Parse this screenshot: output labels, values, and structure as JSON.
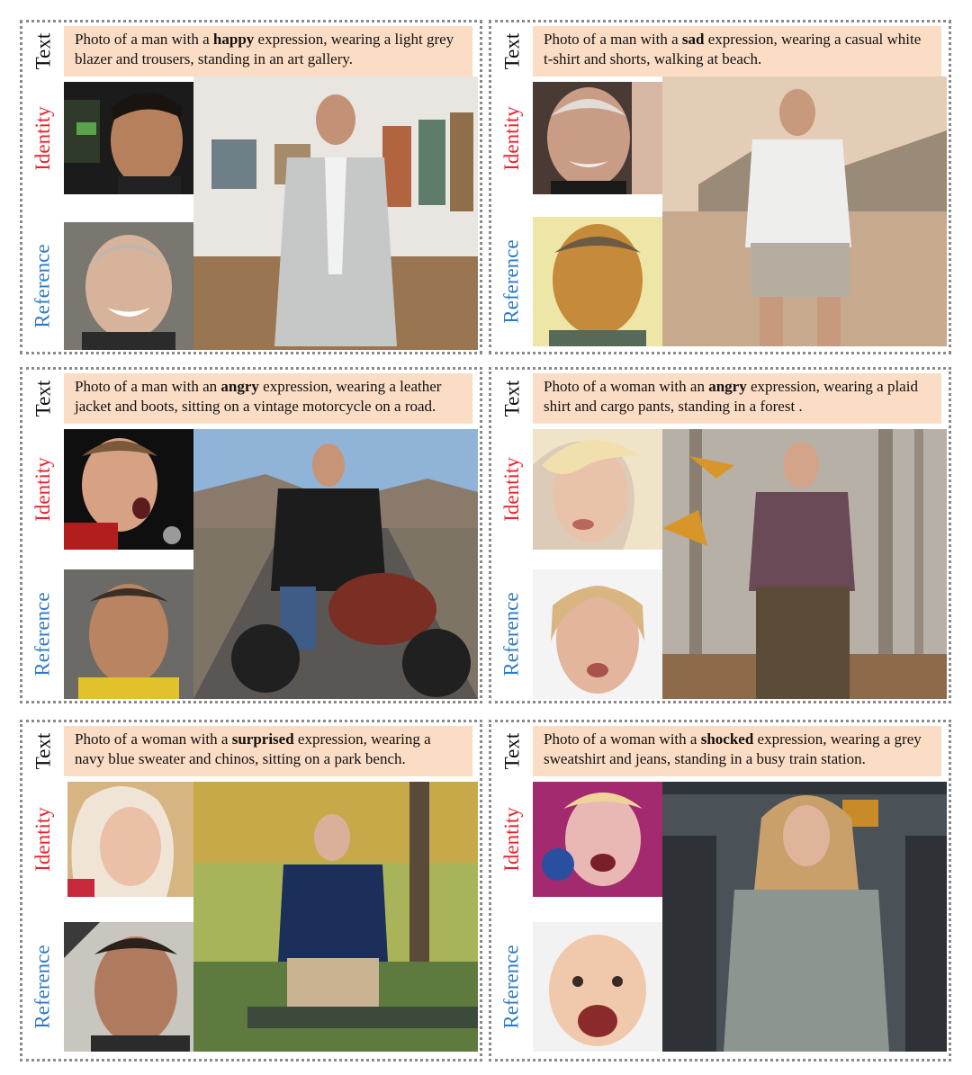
{
  "labels": {
    "text": "Text",
    "identity": "Identity",
    "reference": "Reference"
  },
  "panels": [
    {
      "pre": "Photo of a man with a ",
      "emotion": "happy",
      "post": " expression, wearing a light grey blazer and trousers, standing in an art gallery."
    },
    {
      "pre": "Photo of a man with a ",
      "emotion": "sad",
      "post": " expression, wearing a casual white t-shirt and shorts, walking at beach."
    },
    {
      "pre": "Photo of a man with an ",
      "emotion": "angry",
      "post": " expression, wearing a leather jacket and boots, sitting on a vintage motorcycle on a road."
    },
    {
      "pre": "Photo of a woman with an ",
      "emotion": "angry",
      "post": " expression, wearing a plaid shirt and cargo pants, standing in a forest ."
    },
    {
      "pre": "Photo of a woman with a ",
      "emotion": "surprised",
      "post": " expression, wearing a navy blue sweater and chinos, sitting on a park bench."
    },
    {
      "pre": "Photo of a woman with a ",
      "emotion": "shocked",
      "post": " expression, wearing a grey sweatshirt and jeans, standing in a busy train station."
    }
  ],
  "colors": {
    "text_label": "#111111",
    "identity_label": "#e8212b",
    "reference_label": "#2d7ac4",
    "prompt_bg": "#fbdcc4",
    "border": "#8a8a8a"
  }
}
